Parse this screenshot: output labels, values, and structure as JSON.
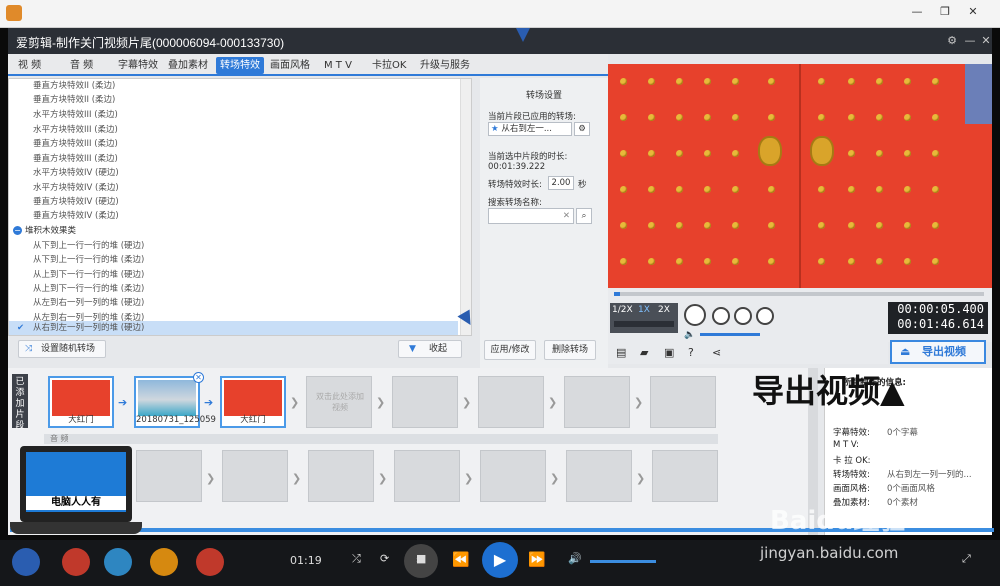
{
  "window": {
    "title": "爱剪辑-制作关门视频片尾(000006094-000133730)"
  },
  "tabs": [
    "视  频",
    "音  频",
    "字幕特效",
    "叠加素材",
    "转场特效",
    "画面风格",
    "M T V",
    "卡拉OK",
    "升级与服务"
  ],
  "transition_list": {
    "items": [
      "垂直方块特效II (柔边)",
      "垂直方块特效II (柔边)",
      "水平方块特效III (柔边)",
      "水平方块特效III (柔边)",
      "垂直方块特效III (柔边)",
      "垂直方块特效III (柔边)",
      "水平方块特效IV (硬边)",
      "水平方块特效IV (柔边)",
      "垂直方块特效IV (硬边)",
      "垂直方块特效IV (柔边)"
    ],
    "category": "堆积木效果类",
    "sub_items": [
      "从下到上一行一行的堆 (硬边)",
      "从下到上一行一行的堆 (柔边)",
      "从上到下一行一行的堆 (硬边)",
      "从上到下一行一行的堆 (柔边)",
      "从左到右一列一列的堆 (硬边)",
      "从左到右一列一列的堆 (柔边)",
      "从右到左一列一列的堆 (硬边)"
    ],
    "random_button": "设置随机转场",
    "collapse_button": "收起"
  },
  "settings": {
    "header": "转场设置",
    "applied_label": "当前片段已应用的转场:",
    "applied_value": "从右到左一...",
    "duration_label": "当前选中片段的时长:",
    "duration_value": "00:01:39.222",
    "effect_time_label": "转场特效时长:",
    "effect_time_value": "2.00",
    "effect_time_unit": "秒",
    "search_label": "搜索转场名称:",
    "apply_button": "应用/修改",
    "delete_button": "删除转场"
  },
  "preview": {
    "speeds": [
      "1/2X",
      "1X",
      "2X"
    ],
    "time_current": "00:00:05.400",
    "time_total": "00:01:46.614",
    "export_button": "导出视频"
  },
  "timeline": {
    "track_label": "已添加片段",
    "clips": [
      "大红门",
      "20180731_125059",
      "大红门"
    ],
    "add_hint": "双击此处添加视频",
    "audio_label": "音 频"
  },
  "info_panel": {
    "title": "所有制作的信息:",
    "rows": [
      {
        "k": "字幕特效:",
        "v": "0个字幕"
      },
      {
        "k": "M  T  V:",
        "v": ""
      },
      {
        "k": "卡 拉 OK:",
        "v": ""
      },
      {
        "k": "转场特效:",
        "v": "从右到左一列一列的..."
      },
      {
        "k": "画面风格:",
        "v": "0个画面风格"
      },
      {
        "k": "叠加素材:",
        "v": "0个素材"
      }
    ]
  },
  "overlay": {
    "big_text": "导出视频▲",
    "laptop_text": "电脑人人有"
  },
  "player": {
    "time": "01:19"
  },
  "watermark": {
    "line1": "Baidu经验",
    "line2": "jingyan.baidu.com"
  }
}
